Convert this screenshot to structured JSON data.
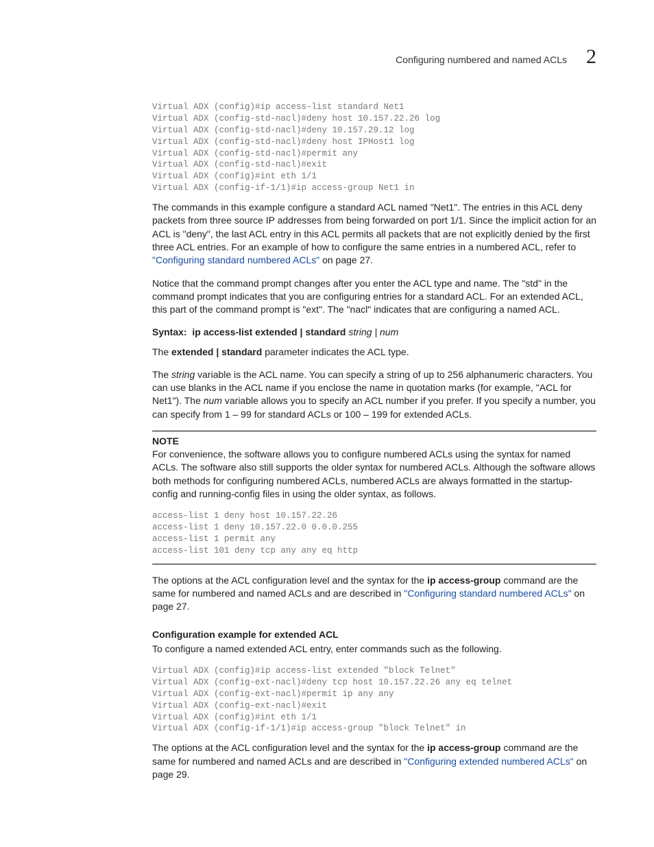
{
  "header": {
    "title": "Configuring numbered and named ACLs",
    "chapter_number": "2"
  },
  "code_block_1": "Virtual ADX (config)#ip access-list standard Net1\nVirtual ADX (config-std-nacl)#deny host 10.157.22.26 log\nVirtual ADX (config-std-nacl)#deny 10.157.29.12 log\nVirtual ADX (config-std-nacl)#deny host IPHost1 log\nVirtual ADX (config-std-nacl)#permit any\nVirtual ADX (config-std-nacl)#exit\nVirtual ADX (config)#int eth 1/1\nVirtual ADX (config-if-1/1)#ip access-group Net1 in",
  "para_1a": "The commands in this example configure a standard ACL named \"Net1\". The entries in this ACL deny packets from three source IP addresses from being forwarded on port 1/1. Since the implicit action for an ACL is \"deny\", the last ACL entry in this ACL permits all packets that are not explicitly denied by the first three ACL entries. For an example of how to configure the same entries in a numbered ACL, refer to ",
  "link_1": "\"Configuring standard numbered ACLs\"",
  "para_1b": " on page 27.",
  "para_2": "Notice that the command prompt changes after you enter the ACL type and name. The \"std\" in the command prompt indicates that you are configuring entries for a standard ACL. For an extended ACL, this part of the command prompt is \"ext\". The \"nacl\" indicates that are configuring a named ACL.",
  "syntax": {
    "label": "Syntax:",
    "cmd": "ip access-list extended | standard",
    "args": "string | num"
  },
  "para_3a": "The ",
  "para_3b": "extended | standard",
  "para_3c": " parameter indicates the ACL type.",
  "para_4a": "The ",
  "para_4_i1": "string",
  "para_4b": " variable is the ACL name. You can specify a string of up to 256 alphanumeric characters. You can use blanks in the ACL name if you enclose the name in quotation marks (for example, \"ACL for Net1\"). The ",
  "para_4_i2": "num",
  "para_4c": " variable allows you to specify an ACL number if you prefer. If you specify a number, you can specify from 1 – 99 for standard ACLs or 100 – 199 for extended ACLs.",
  "note": {
    "head": "NOTE",
    "body": "For convenience, the software allows you to configure numbered ACLs using the syntax for named ACLs. The software also still supports the older syntax for numbered ACLs. Although the software allows both methods for configuring numbered ACLs, numbered ACLs are always formatted in the startup-config and running-config files in using the older syntax, as follows.",
    "code": "access-list 1 deny host 10.157.22.26\naccess-list 1 deny 10.157.22.0 0.0.0.255\naccess-list 1 permit any\naccess-list 101 deny tcp any any eq http"
  },
  "para_5a": "The options at the ACL configuration level and the syntax for the ",
  "para_5_b": "ip access-group",
  "para_5b": " command are the same for numbered and named ACLs and are described in ",
  "link_2": "\"Configuring standard numbered ACLs\"",
  "para_5c": " on page 27.",
  "subhead_1": "Configuration example for extended ACL",
  "para_6": "To configure a named extended ACL entry, enter commands such as the following.",
  "code_block_2": "Virtual ADX (config)#ip access-list extended \"block Telnet\"\nVirtual ADX (config-ext-nacl)#deny tcp host 10.157.22.26 any eq telnet\nVirtual ADX (config-ext-nacl)#permit ip any any\nVirtual ADX (config-ext-nacl)#exit\nVirtual ADX (config)#int eth 1/1\nVirtual ADX (config-if-1/1)#ip access-group \"block Telnet\" in",
  "para_7a": "The options at the ACL configuration level and the syntax for the ",
  "para_7_b": "ip access-group",
  "para_7b": " command are the same for numbered and named ACLs and are described in ",
  "link_3": "\"Configuring extended numbered ACLs\"",
  "para_7c": " on page 29."
}
